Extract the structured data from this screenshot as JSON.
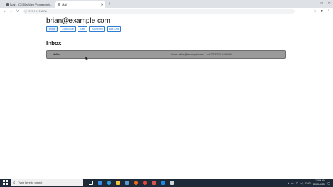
{
  "browser": {
    "tabs": [
      {
        "title": "Mail - (CS50's Web Programmin...",
        "active": false
      },
      {
        "title": "Mail",
        "active": true
      }
    ],
    "new_tab_label": "+",
    "address": "127.0.0.1:8000",
    "window_controls": [
      "–",
      "□",
      "✕"
    ]
  },
  "page": {
    "user_email": "brian@example.com",
    "nav_buttons": [
      "Inbox",
      "Compose",
      "Sent",
      "Archived",
      "Log Out"
    ],
    "active_nav": "Inbox",
    "section_title": "Inbox",
    "emails": [
      {
        "sender": "Hello",
        "meta": "From: alice@example.com - Jul 23 2020, 9:56 AM"
      }
    ]
  },
  "taskbar": {
    "search_placeholder": "Type here to search",
    "language": "ENG",
    "time": "11:06 AM",
    "date": "10-09-2020"
  },
  "colors": {
    "accent": "#2f7cd3",
    "email_row_bg": "#9a9a9a",
    "taskbar_bg": "#1f2a38"
  }
}
